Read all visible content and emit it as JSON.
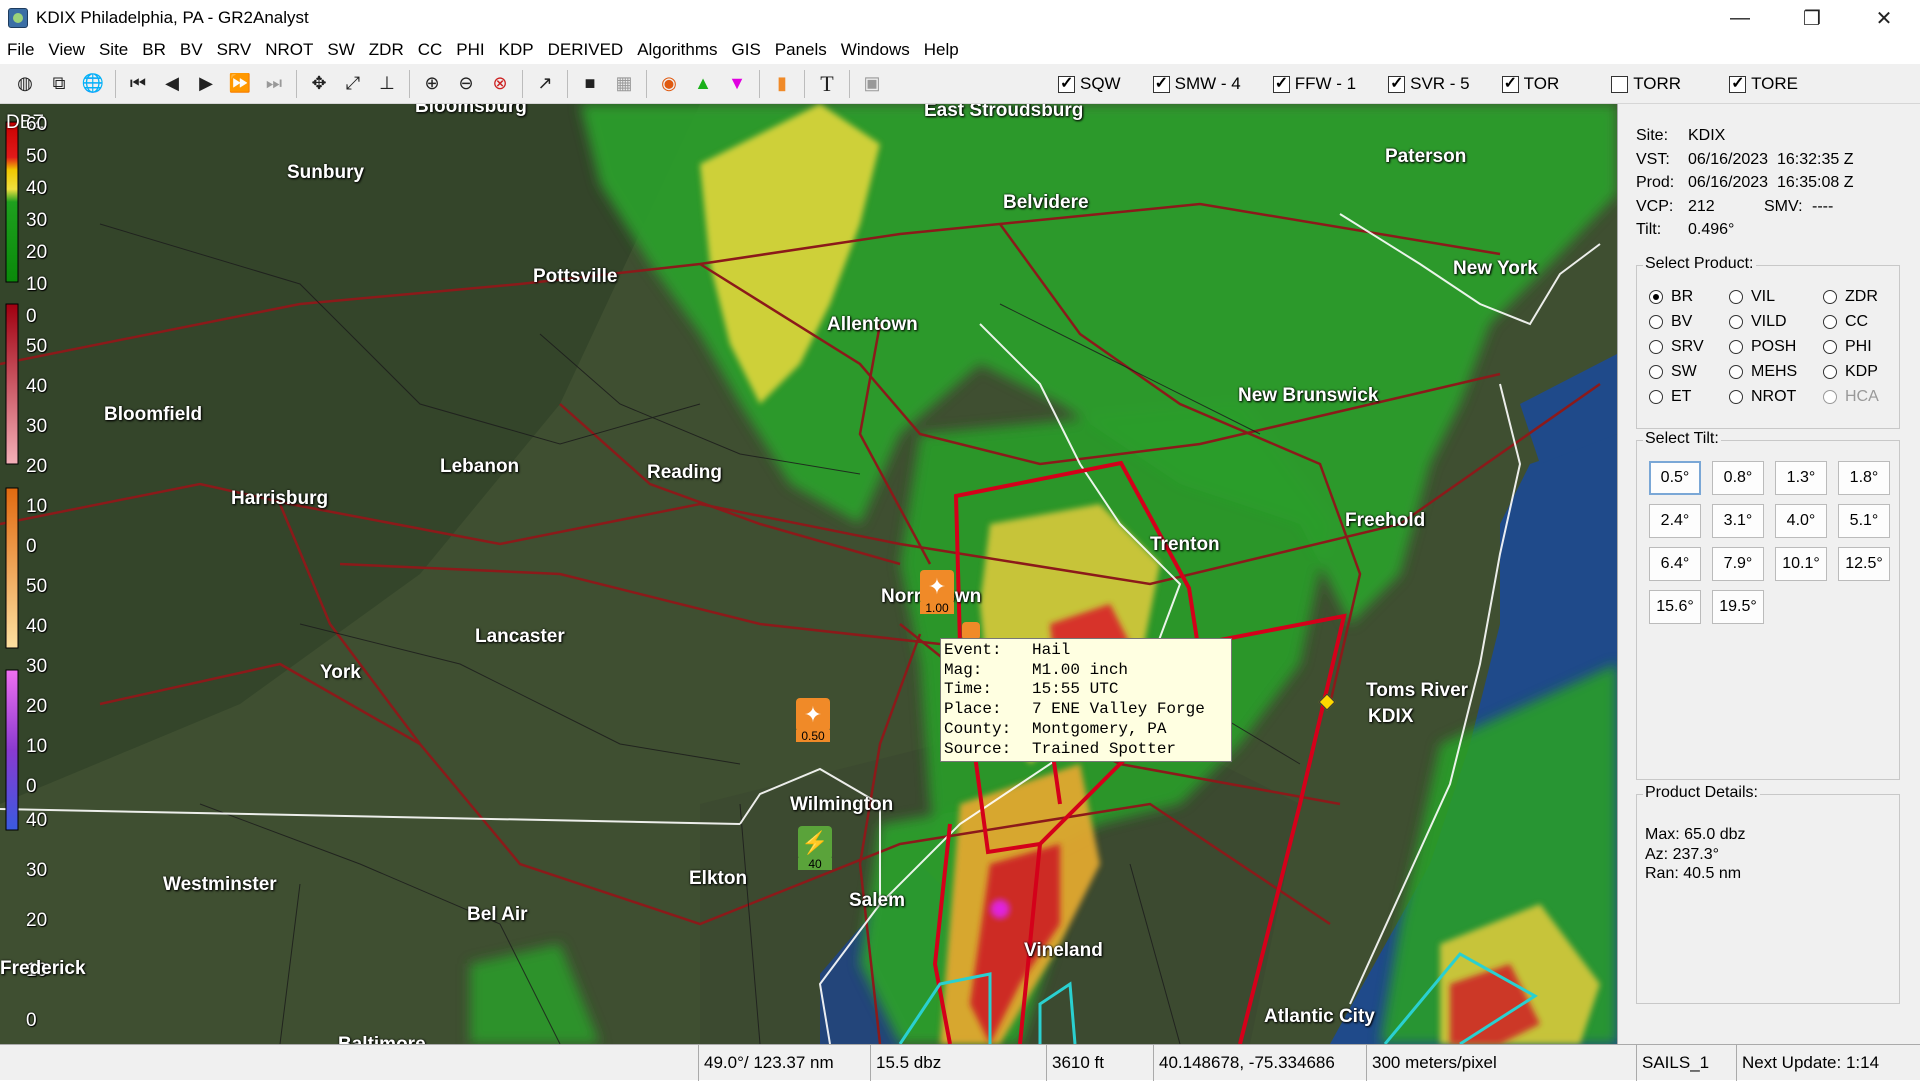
{
  "window": {
    "title": "KDIX Philadelphia, PA - GR2Analyst",
    "controls": [
      "—",
      "❐",
      "✕"
    ]
  },
  "menu": [
    "File",
    "View",
    "Site",
    "BR",
    "BV",
    "SRV",
    "NROT",
    "SW",
    "ZDR",
    "CC",
    "PHI",
    "KDP",
    "DERIVED",
    "Algorithms",
    "GIS",
    "Panels",
    "Windows",
    "Help"
  ],
  "warning_toggles": [
    {
      "label": "SQW",
      "checked": true
    },
    {
      "label": "SMW - 4",
      "checked": true
    },
    {
      "label": "FFW - 1",
      "checked": true
    },
    {
      "label": "SVR - 5",
      "checked": true
    },
    {
      "label": "TOR",
      "checked": true
    },
    {
      "label": "TORR",
      "checked": false
    },
    {
      "label": "TORE",
      "checked": true
    }
  ],
  "legend": {
    "title": "DBZ",
    "labels": [
      "60",
      "50",
      "40",
      "30",
      "20",
      "10",
      "0",
      "50",
      "40",
      "30",
      "20",
      "10",
      "0",
      "50",
      "40",
      "30",
      "20",
      "10",
      "0",
      "40",
      "30",
      "20",
      "10",
      "0"
    ]
  },
  "cities": [
    "East Stroudsburg",
    "Paterson",
    "Sunbury",
    "Belvidere",
    "New York",
    "Pottsville",
    "Allentown",
    "Bloomfield",
    "New Brunswick",
    "Lebanon",
    "Reading",
    "Harrisburg",
    "Freehold",
    "Trenton",
    "Norristown",
    "Lancaster",
    "York",
    "Toms River",
    "KDIX",
    "Wilmington",
    "Westminster",
    "Elkton",
    "Bel Air",
    "Salem",
    "Vineland",
    "Atlantic City",
    "Frederick",
    "Bloomsburg",
    "Baltimore"
  ],
  "reports": [
    {
      "type": "hail",
      "value": "1.00"
    },
    {
      "type": "hail",
      "value": "0.50"
    },
    {
      "type": "wind",
      "value": "40"
    }
  ],
  "popup": {
    "rows": [
      {
        "k": "Event:",
        "v": "Hail"
      },
      {
        "k": "Mag:",
        "v": "M1.00 inch"
      },
      {
        "k": "Time:",
        "v": "15:55 UTC"
      },
      {
        "k": "Place:",
        "v": "7 ENE Valley Forge"
      },
      {
        "k": "County:",
        "v": "Montgomery, PA"
      },
      {
        "k": "Source:",
        "v": "Trained Spotter"
      }
    ]
  },
  "info": {
    "site_label": "Site:",
    "site": "KDIX",
    "vst_label": "VST:",
    "vst": "06/16/2023  16:32:35 Z",
    "prod_label": "Prod:",
    "prod": "06/16/2023  16:35:08 Z",
    "vcp_label": "VCP:",
    "vcp": "212",
    "smv_label": "SMV:",
    "smv": "----",
    "tilt_label": "Tilt:",
    "tilt": "0.496°"
  },
  "select_product": {
    "title": "Select Product:",
    "items": [
      {
        "label": "BR",
        "selected": true,
        "disabled": false
      },
      {
        "label": "VIL",
        "selected": false,
        "disabled": false
      },
      {
        "label": "ZDR",
        "selected": false,
        "disabled": false
      },
      {
        "label": "BV",
        "selected": false,
        "disabled": false
      },
      {
        "label": "VILD",
        "selected": false,
        "disabled": false
      },
      {
        "label": "CC",
        "selected": false,
        "disabled": false
      },
      {
        "label": "SRV",
        "selected": false,
        "disabled": false
      },
      {
        "label": "POSH",
        "selected": false,
        "disabled": false
      },
      {
        "label": "PHI",
        "selected": false,
        "disabled": false
      },
      {
        "label": "SW",
        "selected": false,
        "disabled": false
      },
      {
        "label": "MEHS",
        "selected": false,
        "disabled": false
      },
      {
        "label": "KDP",
        "selected": false,
        "disabled": false
      },
      {
        "label": "ET",
        "selected": false,
        "disabled": false
      },
      {
        "label": "NROT",
        "selected": false,
        "disabled": false
      },
      {
        "label": "HCA",
        "selected": false,
        "disabled": true
      }
    ]
  },
  "select_tilt": {
    "title": "Select Tilt:",
    "items": [
      "0.5°",
      "0.8°",
      "1.3°",
      "1.8°",
      "2.4°",
      "3.1°",
      "4.0°",
      "5.1°",
      "6.4°",
      "7.9°",
      "10.1°",
      "12.5°",
      "15.6°",
      "19.5°"
    ],
    "selected": "0.5°"
  },
  "product_details": {
    "title": "Product Details:",
    "max_label": "Max:",
    "max": "65.0 dbz",
    "az_label": "Az:",
    "az": "237.3°",
    "ran_label": "Ran:",
    "ran": "40.5 nm"
  },
  "status": {
    "cells": [
      "49.0°/ 123.37 nm",
      "15.5 dbz",
      "3610 ft",
      "40.148678, -75.334686",
      "300 meters/pixel",
      "SAILS_1",
      "Next Update: 1:14"
    ]
  },
  "colors": {
    "warning_red": "#d4001a",
    "marine_cyan": "#2ad0d0",
    "hail_orange": "#f08a28",
    "wind_green": "#5aa33a",
    "ocean": "#1f4a8a"
  }
}
